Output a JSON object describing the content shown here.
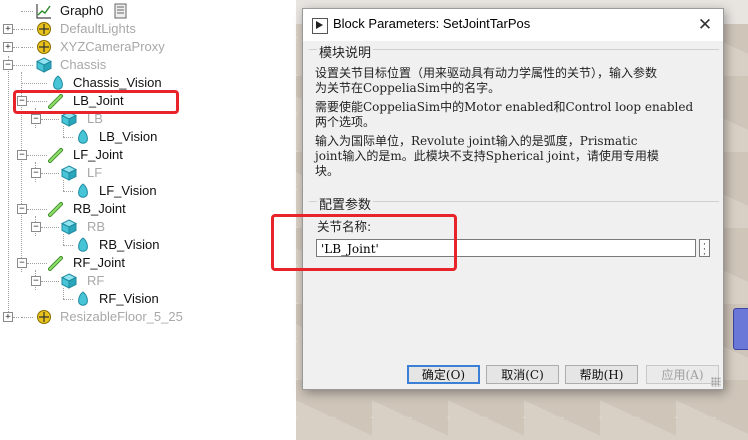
{
  "tree": {
    "items": [
      {
        "label": "Graph0",
        "dim": false
      },
      {
        "label": "DefaultLights",
        "dim": true
      },
      {
        "label": "XYZCameraProxy",
        "dim": true
      },
      {
        "label": "Chassis",
        "dim": true
      },
      {
        "label": "Chassis_Vision",
        "dim": false
      },
      {
        "label": "LB_Joint",
        "dim": false
      },
      {
        "label": "LB",
        "dim": true
      },
      {
        "label": "LB_Vision",
        "dim": false
      },
      {
        "label": "LF_Joint",
        "dim": false
      },
      {
        "label": "LF",
        "dim": true
      },
      {
        "label": "LF_Vision",
        "dim": false
      },
      {
        "label": "RB_Joint",
        "dim": false
      },
      {
        "label": "RB",
        "dim": true
      },
      {
        "label": "RB_Vision",
        "dim": false
      },
      {
        "label": "RF_Joint",
        "dim": false
      },
      {
        "label": "RF",
        "dim": true
      },
      {
        "label": "RF_Vision",
        "dim": false
      },
      {
        "label": "ResizableFloor_5_25",
        "dim": true
      }
    ]
  },
  "dialog": {
    "title": "Block Parameters: SetJointTarPos",
    "close_glyph": "✕",
    "description_group": "模块说明",
    "desc_lines": [
      "设置关节目标位置（用来驱动具有动力学属性的关节），输入参数",
      "为关节在CoppeliaSim中的名字。",
      "需要使能CoppeliaSim中的Motor enabled和Control loop enabled",
      "两个选项。",
      "输入为国际单位，Revolute joint输入的是弧度，Prismatic",
      "joint输入的是m。此模块不支持Spherical joint，请使用专用模",
      "块。"
    ],
    "config_group": "配置参数",
    "param_label": "关节名称:",
    "param_value": "'LB_Joint'",
    "buttons": {
      "ok": "确定(O)",
      "cancel": "取消(C)",
      "help": "帮助(H)",
      "apply": "应用(A)"
    }
  },
  "colors": {
    "highlight": "#e8242a",
    "selection_border": "#3c7fd6",
    "joint_icon": "#66c04a",
    "shape_icon": "#47c4d6",
    "light_icon": "#e9c21b"
  }
}
